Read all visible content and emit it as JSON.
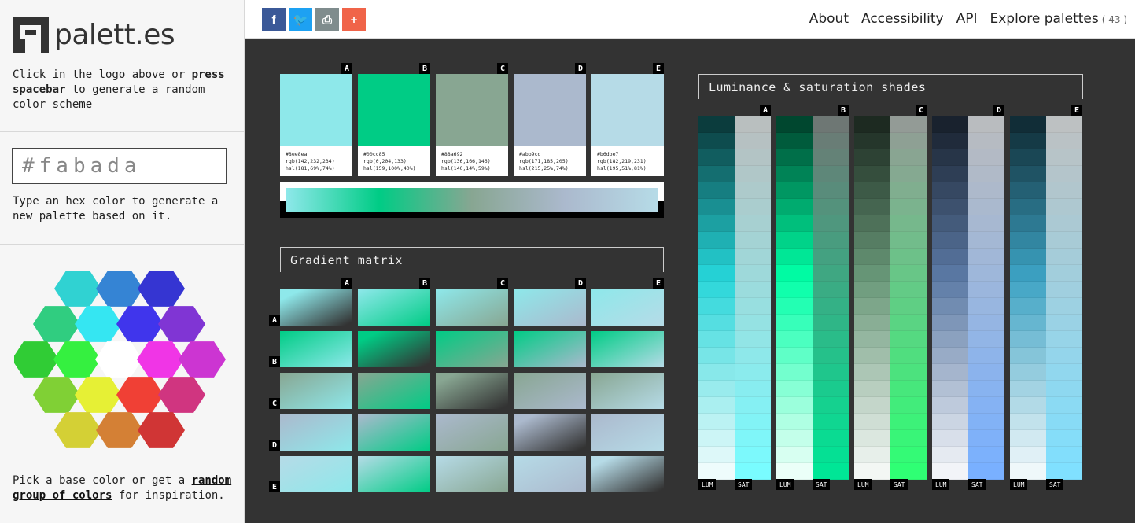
{
  "logo": {
    "text": "palett.es"
  },
  "sidebar": {
    "intro": {
      "pre": "Click in the logo above or ",
      "bold": "press spacebar",
      "post": " to generate a random color scheme"
    },
    "hex_placeholder": "#fabada",
    "hex_help": "Type an hex color to generate a new palette based on it.",
    "pick": {
      "pre": "Pick a base color or get a ",
      "link": "random group of colors",
      "post": " for inspiration."
    }
  },
  "share": [
    {
      "name": "facebook-share-button",
      "label": "f",
      "color": "#3b5998"
    },
    {
      "name": "twitter-share-button",
      "label": "🐦",
      "color": "#1da1f2"
    },
    {
      "name": "print-button",
      "label": "⎙",
      "color": "#7f8c8d"
    },
    {
      "name": "more-share-button",
      "label": "+",
      "color": "#f06449"
    }
  ],
  "nav": {
    "about": "About",
    "accessibility": "Accessibility",
    "api": "API",
    "explore": "Explore palettes",
    "explore_count": "( 43 )"
  },
  "letters": [
    "A",
    "B",
    "C",
    "D",
    "E"
  ],
  "palette": [
    {
      "hex": "#8ee8ea",
      "rgb": "rgb(142,232,234)",
      "hsl": "hsl(181,69%,74%)"
    },
    {
      "hex": "#00cc85",
      "rgb": "rgb(0,204,133)",
      "hsl": "hsl(159,100%,40%)"
    },
    {
      "hex": "#88a692",
      "rgb": "rgb(136,166,146)",
      "hsl": "hsl(140,14%,59%)"
    },
    {
      "hex": "#abb9cd",
      "rgb": "rgb(171,185,205)",
      "hsl": "hsl(215,25%,74%)"
    },
    {
      "hex": "#b6dbe7",
      "rgb": "rgb(182,219,231)",
      "hsl": "hsl(195,51%,81%)"
    }
  ],
  "sections": {
    "gradient_matrix": "Gradient matrix",
    "shades": "Luminance & saturation shades"
  },
  "shade_tags": {
    "lum": "LUM",
    "sat": "SAT"
  },
  "hex_colors": [
    [
      "#30d2d2",
      "#3584d4",
      "#3535d2"
    ],
    [
      "#30cd80",
      "#35e6f2",
      "#4035ec",
      "#8035d4"
    ],
    [
      "#30cc35",
      "#35f040",
      "#ffffff",
      "#f035e6",
      "#cc35d2"
    ],
    [
      "#80d035",
      "#e6f035",
      "#f04035",
      "#d03580"
    ],
    [
      "#d4d035",
      "#d48035",
      "#d03535"
    ]
  ]
}
